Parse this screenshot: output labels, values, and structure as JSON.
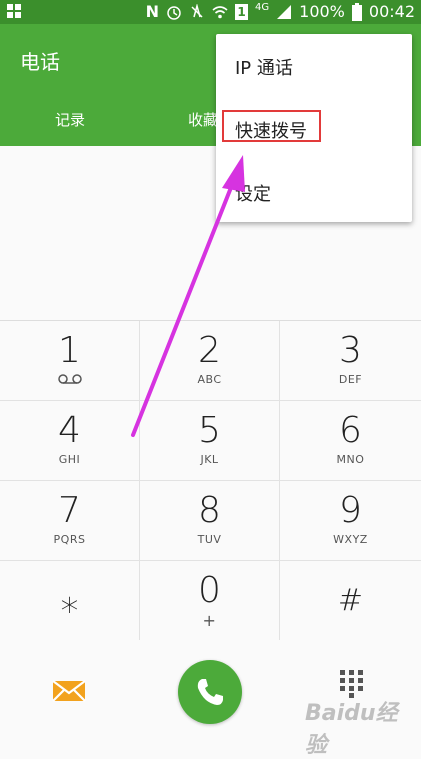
{
  "status_bar": {
    "battery": "100%",
    "time": "00:42",
    "network": "4G",
    "n_badge": "N",
    "sim_badge": "1"
  },
  "header": {
    "title": "电话",
    "tabs": [
      "记录",
      "收藏"
    ]
  },
  "keypad": {
    "keys": [
      {
        "digit": "1",
        "sub": ""
      },
      {
        "digit": "2",
        "sub": "ABC"
      },
      {
        "digit": "3",
        "sub": "DEF"
      },
      {
        "digit": "4",
        "sub": "GHI"
      },
      {
        "digit": "5",
        "sub": "JKL"
      },
      {
        "digit": "6",
        "sub": "MNO"
      },
      {
        "digit": "7",
        "sub": "PQRS"
      },
      {
        "digit": "8",
        "sub": "TUV"
      },
      {
        "digit": "9",
        "sub": "WXYZ"
      },
      {
        "digit": "⁎",
        "sub": ""
      },
      {
        "digit": "0",
        "sub": "+"
      },
      {
        "digit": "#",
        "sub": ""
      }
    ]
  },
  "menu": {
    "items": [
      "IP 通话",
      "快速拨号",
      "设定"
    ],
    "highlighted_index": 1
  },
  "bottom_bar": {
    "watermark": "Baidu经验"
  },
  "colors": {
    "header_green": "#4caa3a",
    "status_green": "#3b8f2c",
    "call_button": "#4caa3a",
    "message_icon": "#f2a21e",
    "highlight_box": "#e23a3a",
    "arrow": "#d633e0"
  },
  "icons": {
    "voicemail": "voicemail-icon",
    "message": "message-icon",
    "call": "phone-icon",
    "dialpad": "dialpad-icon"
  }
}
